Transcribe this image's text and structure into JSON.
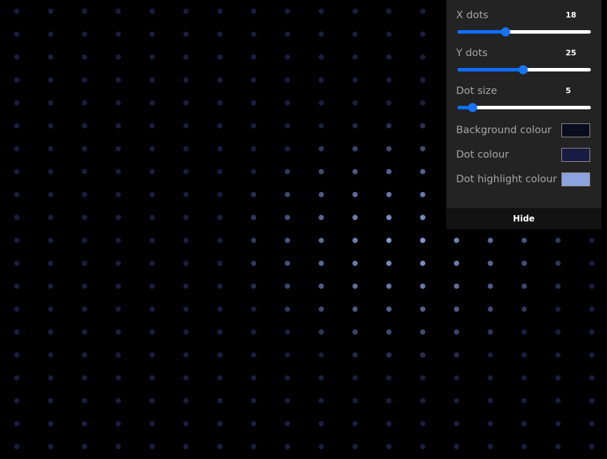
{
  "canvas": {
    "cols": 18,
    "rows": 20,
    "dot_size": 5,
    "background_colour": "#000000",
    "dot_colour": "#1a1d40",
    "dot_highlight_colour": "#8aa0d8",
    "highlight_center": {
      "col": 11.5,
      "row": 10
    }
  },
  "controls": {
    "x_dots": {
      "label": "X dots",
      "value": "18",
      "fraction": 0.36
    },
    "y_dots": {
      "label": "Y dots",
      "value": "25",
      "fraction": 0.49
    },
    "dot_size": {
      "label": "Dot size",
      "value": "5",
      "fraction": 0.11
    },
    "background_colour": {
      "label": "Background colour",
      "value": "#0a0d1e"
    },
    "dot_colour": {
      "label": "Dot colour",
      "value": "#181b42"
    },
    "dot_highlight_colour": {
      "label": "Dot highlight colour",
      "value": "#8da3df"
    },
    "hide_label": "Hide"
  }
}
